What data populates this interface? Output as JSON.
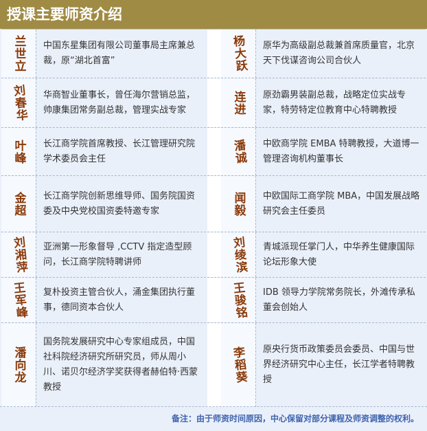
{
  "header": {
    "title": "授课主要师资介绍"
  },
  "rows": [
    {
      "left": {
        "name": "兰世立",
        "desc": "中国东星集团有限公司董事局主席兼总裁，原“湖北首富”"
      },
      "right": {
        "name": "杨大跃",
        "desc": "原华为高级副总裁兼首席质量官，北京天下伐谋咨询公司合伙人"
      }
    },
    {
      "left": {
        "name": "刘春华",
        "desc": "华商智业董事长，曾任海尔营销总监，帅康集团常务副总裁，管理实战专家"
      },
      "right": {
        "name": "连进",
        "desc": "原劲霸男装副总裁，战略定位实战专家，特劳特定位教育中心特聘教授"
      }
    },
    {
      "left": {
        "name": "叶峰",
        "desc": "长江商学院首席教授、长江管理研究院学术委员会主任"
      },
      "right": {
        "name": "潘诚",
        "desc": "中欧商学院 EMBA 特聘教授，大道博一管理咨询机构董事长"
      }
    },
    {
      "left": {
        "name": "金超",
        "desc": "长江商学院创新思维导师、国务院国资委及中央党校国资委特邀专家"
      },
      "right": {
        "name": "闻毅",
        "desc": "中欧国际工商学院 MBA，中国发展战略研究会主任委员"
      }
    },
    {
      "left": {
        "name": "刘湘萍",
        "desc": "亚洲第一形象督导 ,CCTV 指定造型顾问，长江商学院特聘讲师"
      },
      "right": {
        "name": "刘绫滨",
        "desc": "青城派现任掌门人，中华养生健康国际论坛形象大使"
      }
    },
    {
      "left": {
        "name": "王军峰",
        "desc": "复朴投资主管合伙人，涌金集团执行董事，德同资本合伙人"
      },
      "right": {
        "name": "王骏铭",
        "desc": "IDB 领导力学院常务院长，外滩传承私董会创始人"
      }
    },
    {
      "left": {
        "name": "潘向龙",
        "desc": "国务院发展研究中心专家组成员，中国社科院经济研究所研究员，师从周小川、诺贝尔经济学奖获得者赫伯特·西蒙教授"
      },
      "right": {
        "name": "李稻葵",
        "desc": "原央行货币政策委员会委员、中国与世界经济研究中心主任，长江学者特聘教授"
      }
    }
  ],
  "footer": {
    "note": "备注：由于师资时间原因，中心保留对部分课程及师资调整的权利。"
  }
}
